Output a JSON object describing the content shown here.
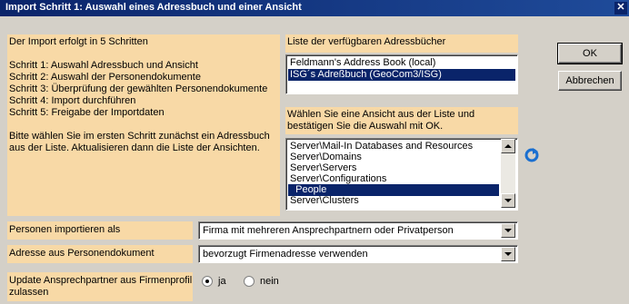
{
  "window": {
    "title": "Import Schritt 1: Auswahl eines Adressbuch und einer Ansicht",
    "close_glyph": "✕"
  },
  "instructions": {
    "lines": [
      "Der Import erfolgt in 5 Schritten",
      "Schritt 1: Auswahl Adressbuch und Ansicht",
      "Schritt 2: Auswahl der Personendokumente",
      "Schritt 3: Überprüfung der gewählten Personendokumente",
      "Schritt 4: Import durchführen",
      "Schritt 5: Freigabe der Importdaten",
      "Bitte wählen Sie im ersten Schritt zunächst ein Adressbuch",
      "aus der Liste. Aktualisieren dann die Liste der Ansichten."
    ]
  },
  "addressbooks": {
    "label": "Liste der verfügbaren Adressbücher",
    "items": [
      "Feldmann's Address Book (local)",
      "ISG´s Adreßbuch (GeoCom3/ISG)"
    ],
    "selected_index": 1
  },
  "views": {
    "label_line1": "Wählen Sie eine Ansicht aus der Liste und",
    "label_line2": "bestätigen Sie die Auswahl mit OK.",
    "items": [
      "Server\\Mail-In Databases and Resources",
      "Server\\Domains",
      "Server\\Servers",
      "Server\\Configurations",
      "  People",
      "Server\\Clusters"
    ],
    "selected_index": 4,
    "refresh_icon": "refresh-icon"
  },
  "buttons": {
    "ok": "OK",
    "cancel": "Abbrechen"
  },
  "form": {
    "persons_label": "Personen importieren als",
    "persons_value": "Firma mit mehreren Ansprechpartnern oder Privatperson",
    "address_label": "Adresse aus Personendokument",
    "address_value": "bevorzugt Firmenadresse verwenden",
    "update_label_line1": "Update Ansprechpartner aus Firmenprofil",
    "update_label_line2": "zulassen",
    "radio_yes": "ja",
    "radio_no": "nein",
    "radio_selected": "ja"
  },
  "colors": {
    "title_bar": "#0a246a",
    "panel": "#f8d9a6",
    "selection": "#0a246a",
    "refresh": "#1a6fd0"
  }
}
